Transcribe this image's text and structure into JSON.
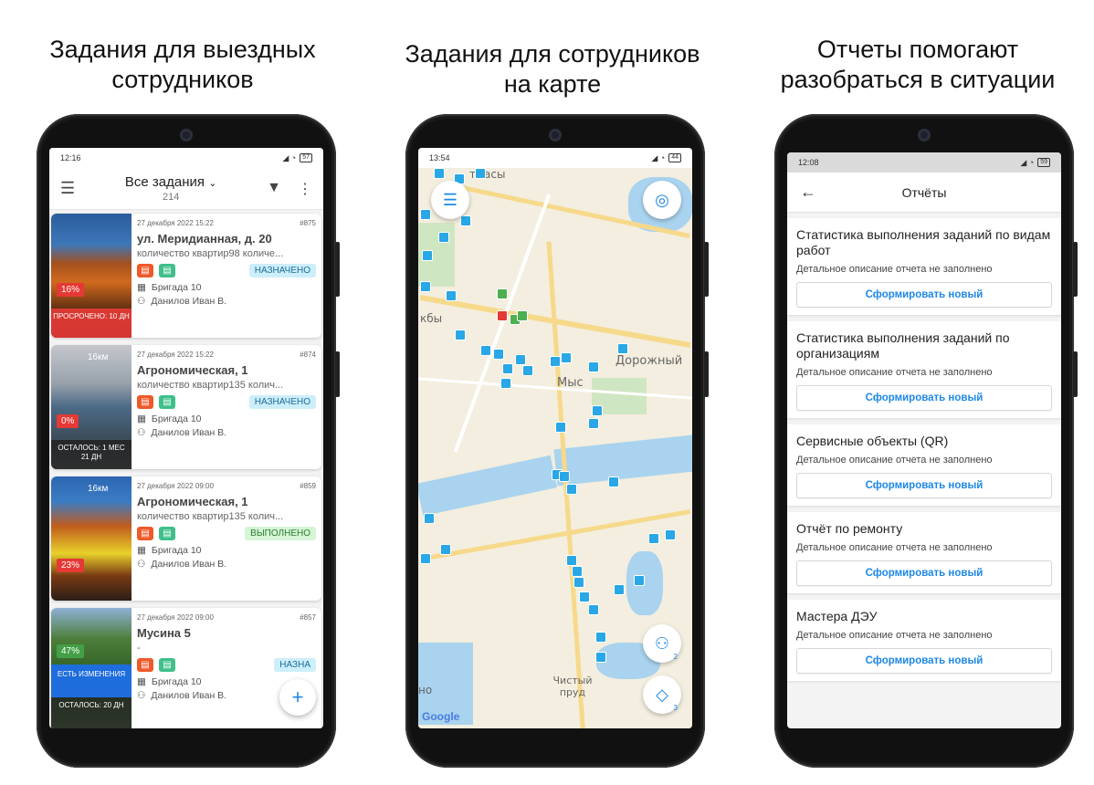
{
  "captions": {
    "left": "Задания для выездных сотрудников",
    "middle": "Задания для сотрудников на карте",
    "right": "Отчеты помогают разобраться в ситуации"
  },
  "phone1": {
    "status": {
      "time": "12:16",
      "battery": "57"
    },
    "header": {
      "title": "Все задания",
      "count": "214"
    },
    "cards": [
      {
        "date": "27 декабря 2022 15:22",
        "num": "#875",
        "address": "ул. Меридианная, д. 20",
        "desc": "количество квартир98 количе...",
        "status": "НАЗНАЧЕНО",
        "brigade": "Бригада 10",
        "person": "Данилов Иван В.",
        "percent": "16%",
        "overlay": "ПРОСРОЧЕНО: 10 ДН",
        "distance": ""
      },
      {
        "date": "27 декабря 2022 15:22",
        "num": "#874",
        "address": "Агрономическая, 1",
        "desc": "количество квартир135 колич...",
        "status": "НАЗНАЧЕНО",
        "brigade": "Бригада 10",
        "person": "Данилов Иван В.",
        "percent": "0%",
        "overlay": "ОСТАЛОСЬ: 1 МЕС 21 ДН",
        "distance": "16км"
      },
      {
        "date": "27 декабря 2022 09:00",
        "num": "#859",
        "address": "Агрономическая, 1",
        "desc": "количество квартир135 колич...",
        "status": "ВЫПОЛНЕНО",
        "brigade": "Бригада 10",
        "person": "Данилов Иван В.",
        "percent": "23%",
        "overlay": "",
        "distance": "16км"
      },
      {
        "date": "27 декабря 2022 09:00",
        "num": "#857",
        "address": "Мусина 5",
        "desc": "-",
        "status": "НАЗНА",
        "brigade": "Бригада 10",
        "person": "Данилов Иван В.",
        "percent": "47%",
        "overlay": "ЕСТЬ ИЗМЕНЕНИЯ",
        "overlay2": "ОСТАЛОСЬ: 20 ДН",
        "distance": ""
      }
    ]
  },
  "phone2": {
    "status": {
      "time": "13:54",
      "battery": "44"
    },
    "labels": {
      "a": "тмасы",
      "b": "кбы",
      "c": "Дорожный",
      "d": "Мыс",
      "e": "Чистый пруд",
      "f": "но"
    },
    "badges": {
      "person": "2",
      "layers": "3"
    },
    "google": "Google"
  },
  "phone3": {
    "status": {
      "time": "12:08",
      "battery": "59"
    },
    "header": {
      "title": "Отчёты"
    },
    "reports": [
      {
        "title": "Статистика выполнения заданий по видам работ",
        "desc": "Детальное описание отчета не заполнено",
        "button": "Сформировать новый"
      },
      {
        "title": "Статистика выполнения заданий по организациям",
        "desc": "Детальное описание отчета не заполнено",
        "button": "Сформировать новый"
      },
      {
        "title": "Сервисные объекты (QR)",
        "desc": "Детальное описание отчета не заполнено",
        "button": "Сформировать новый"
      },
      {
        "title": "Отчёт по ремонту",
        "desc": "Детальное описание отчета не заполнено",
        "button": "Сформировать новый"
      },
      {
        "title": "Мастера ДЭУ",
        "desc": "Детальное описание отчета не заполнено",
        "button": "Сформировать новый"
      }
    ]
  }
}
